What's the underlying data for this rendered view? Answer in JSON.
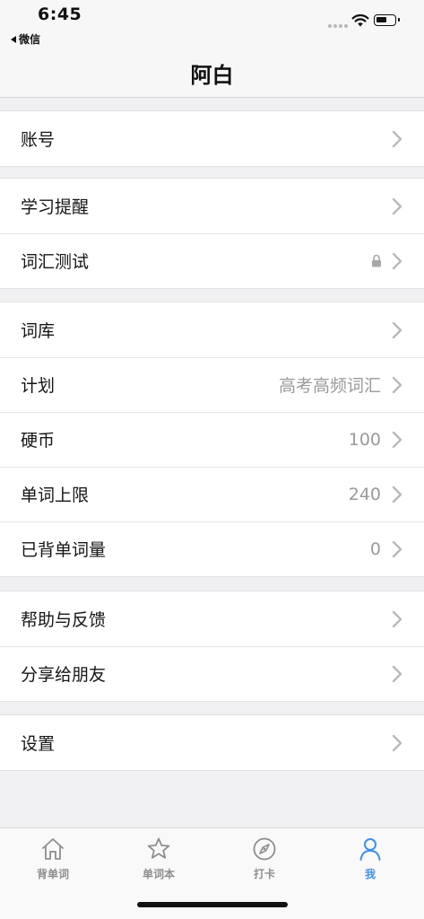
{
  "status_bar": {
    "time": "6:45",
    "back_app": "微信"
  },
  "header": {
    "title": "阿白"
  },
  "groups": [
    {
      "items": [
        {
          "label": "账号",
          "value": ""
        }
      ]
    },
    {
      "items": [
        {
          "label": "学习提醒",
          "value": ""
        },
        {
          "label": "词汇测试",
          "value": "",
          "icon": "lock-icon"
        }
      ]
    },
    {
      "items": [
        {
          "label": "词库",
          "value": ""
        },
        {
          "label": "计划",
          "value": "高考高频词汇"
        },
        {
          "label": "硬币",
          "value": "100"
        },
        {
          "label": "单词上限",
          "value": "240"
        },
        {
          "label": "已背单词量",
          "value": "0"
        }
      ]
    },
    {
      "items": [
        {
          "label": "帮助与反馈",
          "value": ""
        },
        {
          "label": "分享给朋友",
          "value": ""
        }
      ]
    },
    {
      "items": [
        {
          "label": "设置",
          "value": ""
        }
      ]
    }
  ],
  "tabbar": {
    "tabs": [
      {
        "label": "背单词",
        "icon": "home-icon",
        "active": false
      },
      {
        "label": "单词本",
        "icon": "star-icon",
        "active": false
      },
      {
        "label": "打卡",
        "icon": "compass-icon",
        "active": false
      },
      {
        "label": "我",
        "icon": "person-icon",
        "active": true
      }
    ]
  },
  "colors": {
    "accent": "#3d8ff0",
    "inactive": "#8e8e8e",
    "background": "#f0f0f2"
  }
}
